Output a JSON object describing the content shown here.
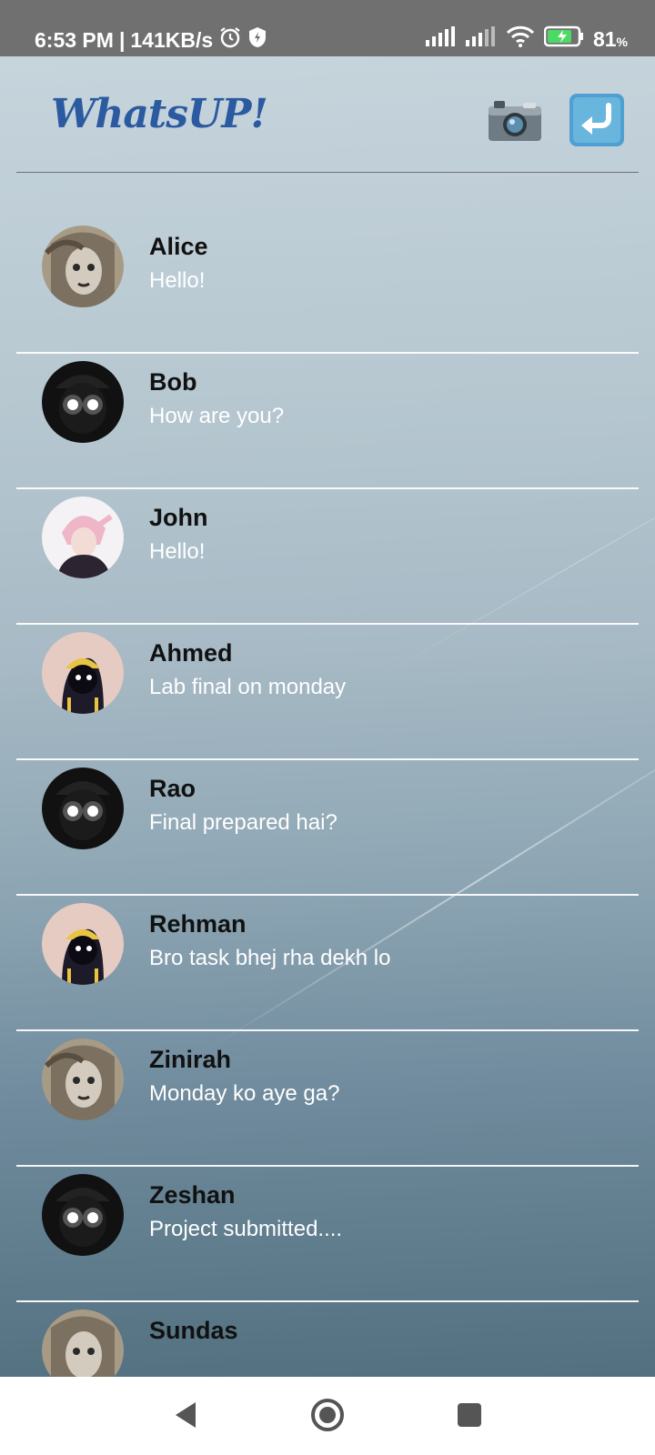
{
  "status_bar": {
    "time": "6:53 PM",
    "separator": "|",
    "speed": "141KB/s",
    "battery_percent": "81",
    "battery_unit": "%",
    "icons": [
      "alarm-icon",
      "shield-icon",
      "signal-icon",
      "signal-icon",
      "wifi-icon",
      "battery-charging-icon"
    ]
  },
  "header": {
    "title": "WhatsUP!",
    "camera_icon": "camera-icon",
    "back_icon": "return-arrow-icon",
    "title_color": "#2b5aa0"
  },
  "chats": [
    {
      "name": "Alice",
      "message": "Hello!",
      "avatar": "avatar-sketch-girl"
    },
    {
      "name": "Bob",
      "message": "How are you?",
      "avatar": "avatar-glowing-eyes"
    },
    {
      "name": "John",
      "message": "Hello!",
      "avatar": "avatar-pink-hair"
    },
    {
      "name": "Ahmed",
      "message": "Lab final on monday",
      "avatar": "avatar-hooded"
    },
    {
      "name": "Rao",
      "message": "Final prepared hai?",
      "avatar": "avatar-glowing-eyes"
    },
    {
      "name": "Rehman",
      "message": "Bro task bhej rha dekh lo",
      "avatar": "avatar-hooded"
    },
    {
      "name": "Zinirah",
      "message": "Monday ko aye ga?",
      "avatar": "avatar-sketch-girl"
    },
    {
      "name": "Zeshan",
      "message": "Project submitted....",
      "avatar": "avatar-glowing-eyes"
    },
    {
      "name": "Sundas",
      "message": "",
      "avatar": "avatar-sketch-girl"
    }
  ],
  "nav_bar": {
    "back_icon": "triangle-back-icon",
    "home_icon": "circle-home-icon",
    "recents_icon": "square-recents-icon"
  }
}
